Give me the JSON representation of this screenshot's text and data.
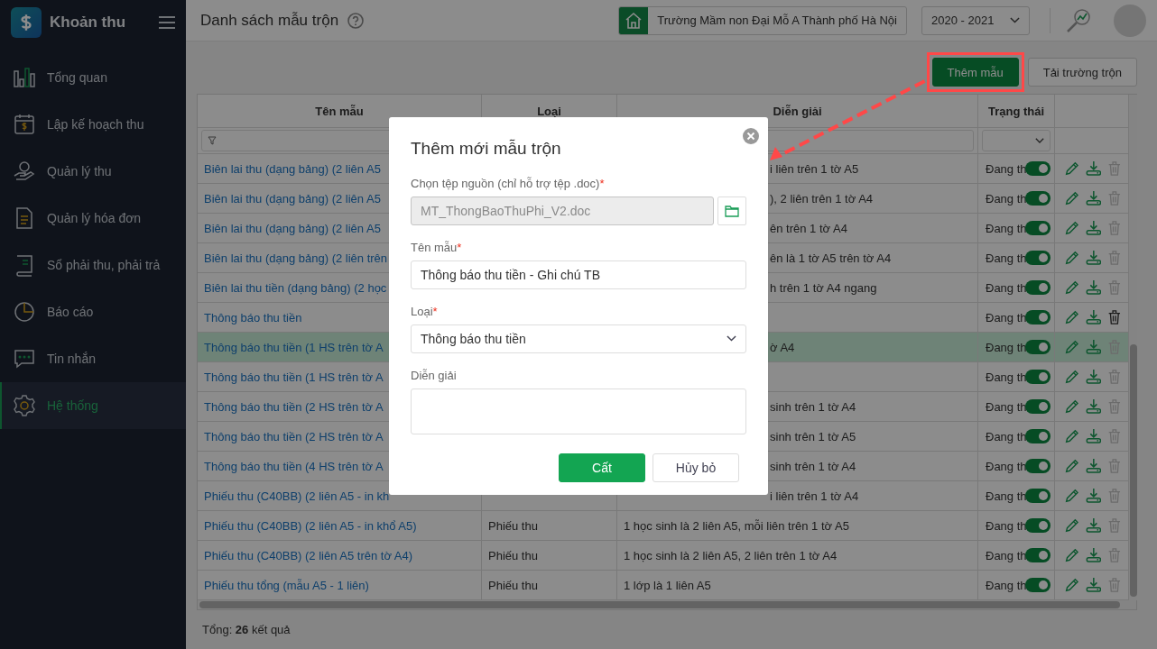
{
  "sidebar": {
    "app_name": "Khoản thu",
    "items": [
      {
        "label": "Tổng quan",
        "selected": false
      },
      {
        "label": "Lập kế hoạch thu",
        "selected": false
      },
      {
        "label": "Quản lý thu",
        "selected": false
      },
      {
        "label": "Quản lý hóa đơn",
        "selected": false
      },
      {
        "label": "Sổ phải thu, phải trả",
        "selected": false
      },
      {
        "label": "Báo cáo",
        "selected": false
      },
      {
        "label": "Tin nhắn",
        "selected": false
      },
      {
        "label": "Hệ thống",
        "selected": true
      }
    ]
  },
  "header": {
    "title": "Danh sách mẫu trộn",
    "school": "Trường Mầm non Đại Mỗ A Thành phố Hà Nội",
    "year": "2020 - 2021"
  },
  "toolbar": {
    "buttons": [
      {
        "label": "Thêm mẫu",
        "kind": "primary",
        "annotated": true
      },
      {
        "label": "Tải trường trộn",
        "kind": "secondary",
        "annotated": false
      }
    ]
  },
  "table": {
    "columns": [
      "Tên mẫu",
      "Loại",
      "Diễn giải",
      "Trạng thái"
    ],
    "rows": [
      {
        "name": "Biên lai thu (dạng bảng) (2 liên A5",
        "description": "i liên trên 1 tờ A5",
        "status": "Đang th",
        "on": true,
        "deletable": false,
        "selected": false
      },
      {
        "name": "Biên lai thu (dạng bảng) (2 liên A5",
        "description": "), 2 liên trên 1 tờ A4",
        "status": "Đang th",
        "on": true,
        "deletable": false,
        "selected": false
      },
      {
        "name": "Biên lai thu (dạng bảng) (2 liên A5",
        "description": "ên trên 1 tờ A4",
        "status": "Đang th",
        "on": true,
        "deletable": false,
        "selected": false
      },
      {
        "name": "Biên lai thu (dạng bảng) (2 liên trên",
        "description": "ên là 1 tờ A5 trên tờ A4",
        "status": "Đang th",
        "on": true,
        "deletable": false,
        "selected": false
      },
      {
        "name": "Biên lai thu tiền (dạng bảng) (2 học",
        "description": "h trên 1 tờ A4 ngang",
        "status": "Đang th",
        "on": true,
        "deletable": false,
        "selected": false
      },
      {
        "name": "Thông báo thu tiền",
        "status": "Đang th",
        "on": true,
        "deletable": true,
        "selected": false
      },
      {
        "name": "Thông báo thu tiền (1 HS trên tờ A",
        "description": "ờ A4",
        "status": "Đang th",
        "on": true,
        "deletable": false,
        "selected": true
      },
      {
        "name": "Thông báo thu tiền (1 HS trên tờ A",
        "status": "Đang th",
        "on": true,
        "deletable": false,
        "selected": false
      },
      {
        "name": "Thông báo thu tiền (2 HS trên tờ A",
        "description": "sinh trên 1 tờ A4",
        "status": "Đang th",
        "on": true,
        "deletable": false,
        "selected": false
      },
      {
        "name": "Thông báo thu tiền (2 HS trên tờ A",
        "description": "sinh trên 1 tờ A5",
        "status": "Đang th",
        "on": true,
        "deletable": false,
        "selected": false
      },
      {
        "name": "Thông báo thu tiền (4 HS trên tờ A",
        "description": "sinh trên 1 tờ A4",
        "status": "Đang th",
        "on": true,
        "deletable": false,
        "selected": false
      },
      {
        "name": "Phiếu thu (C40BB) (2 liên A5 - in kh",
        "description": "i liên trên 1 tờ A4",
        "status": "Đang th",
        "on": true,
        "deletable": false,
        "selected": false
      },
      {
        "name": "Phiếu thu (C40BB) (2 liên A5 - in khổ A5)",
        "type": "Phiếu thu",
        "description": "1 học sinh là 2 liên A5, mỗi liên trên 1 tờ A5",
        "status": "Đang th",
        "on": true,
        "deletable": false,
        "selected": false
      },
      {
        "name": "Phiếu thu (C40BB) (2 liên A5 trên tờ A4)",
        "type": "Phiếu thu",
        "description": "1 học sinh là 2 liên A5, 2 liên trên 1 tờ A4",
        "status": "Đang th",
        "on": true,
        "deletable": false,
        "selected": false
      },
      {
        "name": "Phiếu thu tổng (mẫu A5 - 1 liên)",
        "type": "Phiếu thu",
        "description": "1 lớp là 1 liên A5",
        "status": "Đang th",
        "on": true,
        "deletable": false,
        "selected": false
      }
    ]
  },
  "footer": "Tổng: **26** kết quả",
  "dialog": {
    "title": "Thêm mới mẫu trộn",
    "fields": [
      {
        "kind": "file",
        "label": "Chọn tệp nguồn (chỉ hỗ trợ tệp .doc)",
        "required_mark": "*",
        "value": "MT_ThongBaoThuPhi_V2.doc",
        "disabled": true
      },
      {
        "kind": "text",
        "label": "Tên mẫu",
        "required_mark": "*",
        "value": "Thông báo thu tiền - Ghi chú TB",
        "disabled": false
      },
      {
        "kind": "select",
        "label": "Loại",
        "required_mark": "*",
        "value": "Thông báo thu tiền",
        "disabled": false
      },
      {
        "kind": "textarea",
        "label": "Diễn giải",
        "disabled": false
      }
    ],
    "buttons": [
      {
        "label": "Cất",
        "kind": "primary"
      },
      {
        "label": "Hủy bỏ",
        "kind": "secondary"
      }
    ]
  }
}
